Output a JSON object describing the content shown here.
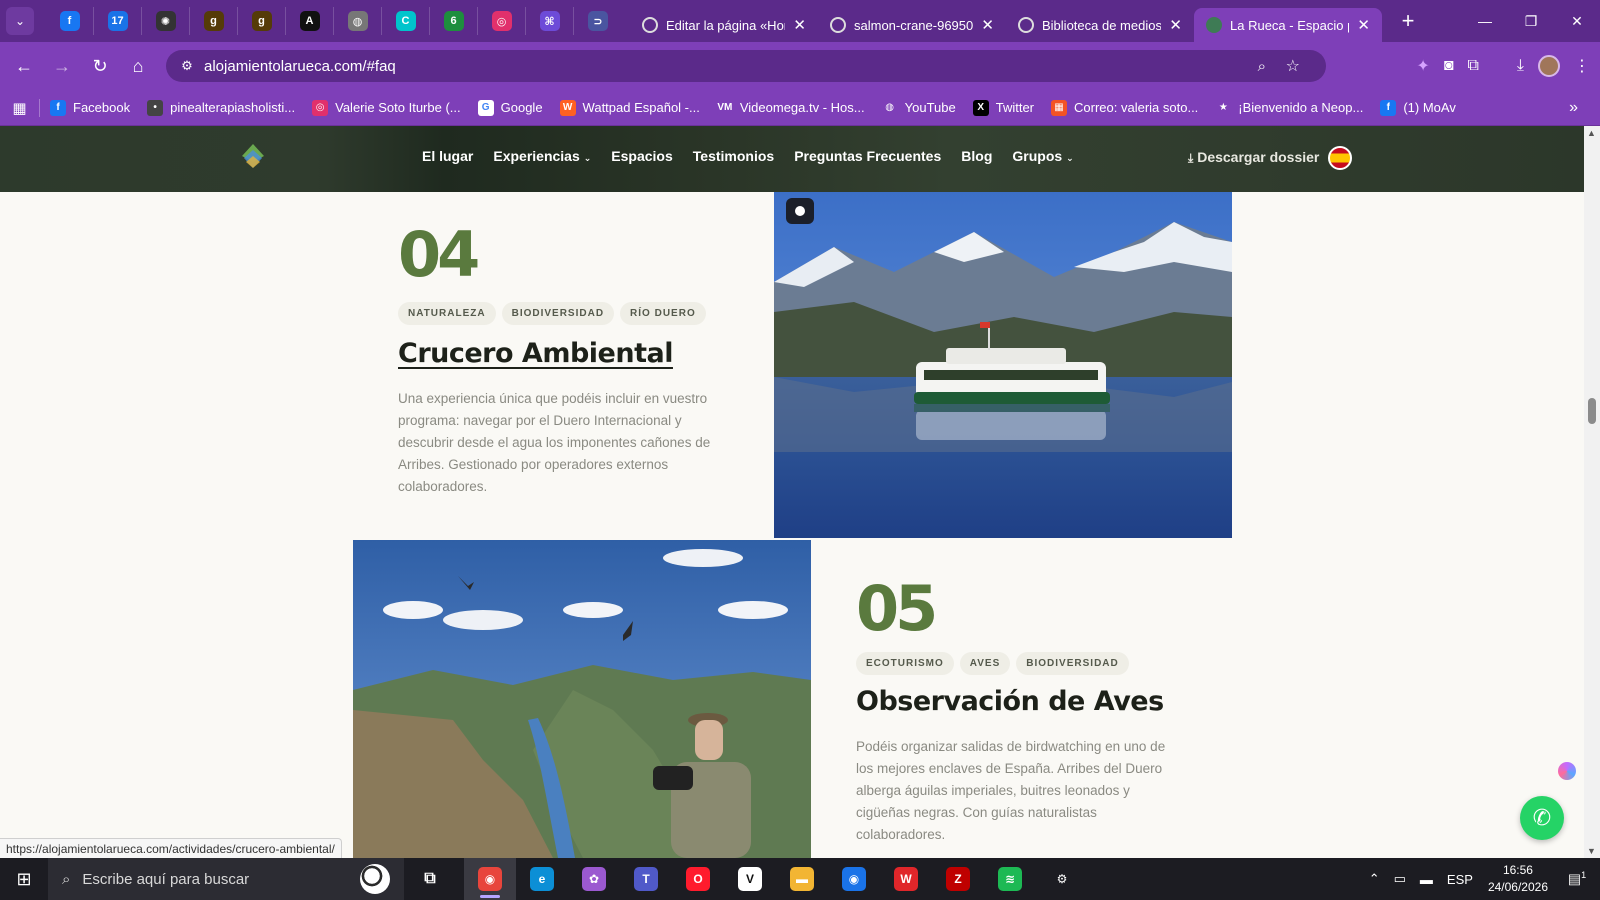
{
  "browser": {
    "pinned_tabs": [
      {
        "icon": "facebook-icon",
        "glyph": "f",
        "color": "#1877f2"
      },
      {
        "icon": "calendar-icon",
        "glyph": "17",
        "color": "#1a73e8"
      },
      {
        "icon": "openai-icon",
        "glyph": "✺",
        "color": "#333"
      },
      {
        "icon": "goodreads-icon",
        "glyph": "g",
        "color": "#553b08"
      },
      {
        "icon": "goodreads-icon",
        "glyph": "g",
        "color": "#553b08"
      },
      {
        "icon": "type-icon",
        "glyph": "A",
        "color": "#111"
      },
      {
        "icon": "globe-icon",
        "glyph": "◍",
        "color": "#777"
      },
      {
        "icon": "canva-icon",
        "glyph": "C",
        "color": "#00c4cc"
      },
      {
        "icon": "badge-icon",
        "glyph": "6",
        "color": "#1e8e3e"
      },
      {
        "icon": "instagram-icon",
        "glyph": "◎",
        "color": "#e1306c"
      },
      {
        "icon": "grid-icon",
        "glyph": "⌘",
        "color": "#6d4bd8"
      },
      {
        "icon": "link-icon",
        "glyph": "⊃",
        "color": "#4a55a0"
      }
    ],
    "tabs": [
      {
        "title": "Editar la página «Hor",
        "active": false
      },
      {
        "title": "salmon-crane-96950",
        "active": false
      },
      {
        "title": "Biblioteca de medios",
        "active": false
      },
      {
        "title": "La Rueca - Espacio pa",
        "active": true
      }
    ],
    "url": "alojamientolarueca.com/#faq",
    "bookmarks": [
      {
        "label": "Facebook",
        "icon": "facebook-icon",
        "color": "#1877f2",
        "glyph": "f"
      },
      {
        "label": "pinealterapiasholisti...",
        "icon": "dot-icon",
        "color": "#444",
        "glyph": "•"
      },
      {
        "label": "Valerie Soto Iturbe (...",
        "icon": "instagram-icon",
        "color": "#e1306c",
        "glyph": "◎"
      },
      {
        "label": "Google",
        "icon": "google-icon",
        "color": "#ffffff",
        "glyph": "G"
      },
      {
        "label": "Wattpad Español -...",
        "icon": "wattpad-icon",
        "color": "#ff6122",
        "glyph": "W"
      },
      {
        "label": "Videomega.tv - Hos...",
        "icon": "videomega-icon",
        "color": "#7e3fb8",
        "glyph": "VM"
      },
      {
        "label": "YouTube",
        "icon": "globe-icon",
        "color": "#7e3fb8",
        "glyph": "◍"
      },
      {
        "label": "Twitter",
        "icon": "x-icon",
        "color": "#000000",
        "glyph": "X"
      },
      {
        "label": "Correo: valeria soto...",
        "icon": "microsoft-icon",
        "color": "#f35325",
        "glyph": "▦"
      },
      {
        "label": "¡Bienvenido a Neop...",
        "icon": "star-icon",
        "color": "#7e3fb8",
        "glyph": "★"
      },
      {
        "label": "(1) MoAv",
        "icon": "facebook-icon",
        "color": "#1877f2",
        "glyph": "f"
      }
    ]
  },
  "site": {
    "nav": [
      "El lugar",
      "Experiencias",
      "Espacios",
      "Testimonios",
      "Preguntas Frecuentes",
      "Blog",
      "Grupos"
    ],
    "dossier": "Descargar dossier",
    "sections": [
      {
        "number": "04",
        "tags": [
          "NATURALEZA",
          "BIODIVERSIDAD",
          "RÍO DUERO"
        ],
        "title": "Crucero Ambiental",
        "text": "Una experiencia única que podéis incluir en vuestro programa: navegar por el Duero Internacional y descubrir desde el agua los imponentes cañones de Arribes. Gestionado por operadores externos colaboradores."
      },
      {
        "number": "05",
        "tags": [
          "ECOTURISMO",
          "AVES",
          "BIODIVERSIDAD"
        ],
        "title": "Observación de Aves",
        "text": "Podéis organizar salidas de birdwatching en uno de los mejores enclaves de España. Arribes del Duero alberga águilas imperiales, buitres leonados y cigüeñas negras. Con guías naturalistas colaboradores."
      }
    ],
    "status_url": "https://alojamientolarueca.com/actividades/crucero-ambiental/"
  },
  "taskbar": {
    "search_placeholder": "Escribe aquí para buscar",
    "apps": [
      {
        "name": "chrome-icon",
        "color": "#e8453c",
        "glyph": "◉",
        "active": true
      },
      {
        "name": "edge-icon",
        "color": "#0c8fd6",
        "glyph": "e",
        "active": false
      },
      {
        "name": "copilot-icon",
        "color": "#9b59d0",
        "glyph": "✿",
        "active": false
      },
      {
        "name": "teams-icon",
        "color": "#5059c9",
        "glyph": "T",
        "active": false
      },
      {
        "name": "opera-icon",
        "color": "#ff1b2d",
        "glyph": "O",
        "active": false
      },
      {
        "name": "vimeo-icon",
        "color": "#ffffff",
        "glyph": "V",
        "active": false
      },
      {
        "name": "folder-icon",
        "color": "#f2b533",
        "glyph": "▬",
        "active": false
      },
      {
        "name": "chrome-profile-icon",
        "color": "#1a73e8",
        "glyph": "◉",
        "active": false
      },
      {
        "name": "wps-icon",
        "color": "#e0262a",
        "glyph": "W",
        "active": false
      },
      {
        "name": "filezilla-icon",
        "color": "#bf0000",
        "glyph": "Z",
        "active": false
      },
      {
        "name": "spotify-icon",
        "color": "#1db954",
        "glyph": "≋",
        "active": false
      },
      {
        "name": "settings-icon",
        "color": "#1c1c22",
        "glyph": "⚙",
        "active": false
      }
    ],
    "lang": "ESP",
    "time": "16:56",
    "date": "24/06/2026",
    "notifications": "1"
  }
}
